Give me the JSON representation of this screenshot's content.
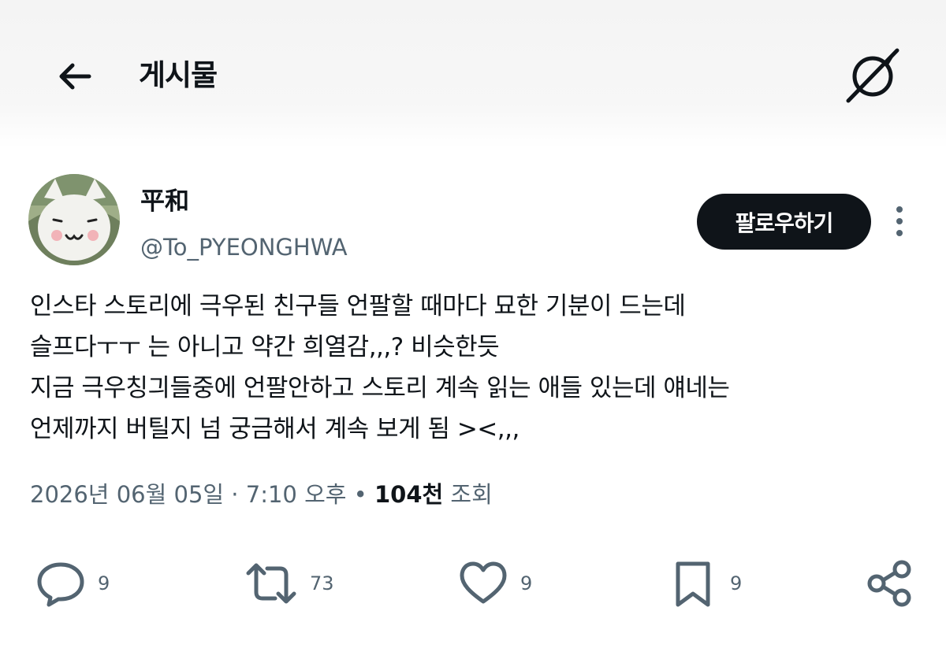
{
  "header": {
    "title": "게시물"
  },
  "author": {
    "display_name": "平和",
    "handle": "@To_PYEONGHWA",
    "follow_label": "팔로우하기"
  },
  "tweet": {
    "lines": [
      "인스타 스토리에 극우된 친구들 언팔할 때마다 묘한 기분이 드는데",
      "슬프다ㅜㅜ 는 아니고 약간 희열감,,,? 비슷한듯",
      "지금 극우칭긔들중에 언팔안하고 스토리 계속 읽는 애들 있는데 얘네는",
      "언제까지 버틸지 넘 궁금해서 계속 보게 됨 ><,,,"
    ]
  },
  "meta": {
    "date": "2026년 06월 05일",
    "sep1": " · ",
    "time": "7:10 오후",
    "sep2": " • ",
    "views_count": "104천",
    "views_label": " 조회"
  },
  "actions": {
    "reply_count": "9",
    "retweet_count": "73",
    "like_count": "9",
    "bookmark_count": "9"
  },
  "icons": {
    "back": "arrow-left-icon",
    "grok": "grok-icon",
    "more": "more-vertical-icon",
    "reply": "reply-icon",
    "retweet": "retweet-icon",
    "like": "heart-icon",
    "bookmark": "bookmark-icon",
    "share": "share-icon"
  },
  "colors": {
    "text": "#0f1419",
    "secondary": "#536471",
    "button": "#0f1419"
  }
}
